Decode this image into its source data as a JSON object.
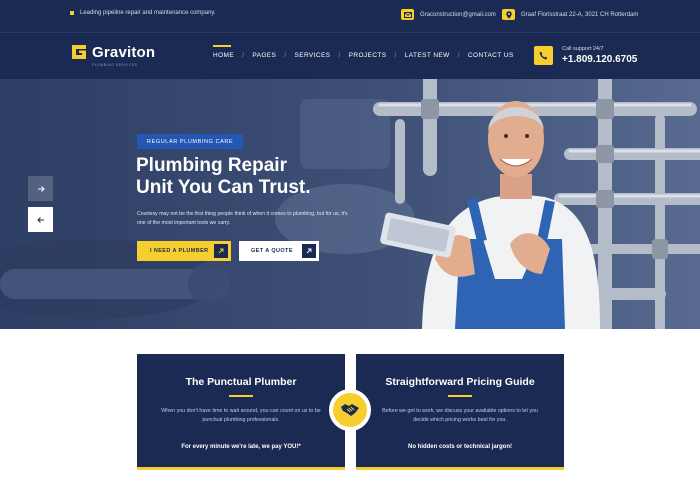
{
  "topbar": {
    "tagline": "Leading pipeline repair and maintenance company.",
    "email": "Graconstruction@gmail.com",
    "address": "Graaf Florisstraat 22-A, 3021 CH Rotterdam"
  },
  "header": {
    "logo_name": "Graviton",
    "logo_sub": "PLUMBING SERVICES",
    "nav": [
      "HOME",
      "PAGES",
      "SERVICES",
      "PROJECTS",
      "LATEST NEW",
      "CONTACT US"
    ],
    "active_nav": "HOME",
    "phone_label": "Call support 24/7",
    "phone_number": "+1.809.120.6705"
  },
  "hero": {
    "badge": "REGULAR PLUMBING CARE",
    "title_line1": "Plumbing Repair",
    "title_line2": "Unit You Can Trust.",
    "description": "Courtesy may not be the first thing people think of when it comes to plumbing, but for us, it's one of the most important tools we carry.",
    "primary_button": "I NEED A PLUMBER",
    "secondary_button": "GET A QUOTE"
  },
  "features": [
    {
      "title": "The Punctual Plumber",
      "text": "When you don't have time to wait around, you can count on us to be punctual plumbing professionals.",
      "footer": "For every minute we're late, we pay YOU!*"
    },
    {
      "title": "Straightforward Pricing Guide",
      "text": "Before we get to work, we discuss your available options to let you decide which pricing works best for you.",
      "footer": "No hidden costs or technical jargon!"
    }
  ],
  "colors": {
    "navy": "#1a2a52",
    "accent_yellow": "#f6cf2e",
    "badge_blue": "#2456b4"
  },
  "icons": {
    "tagline": "square-bullet-icon",
    "email": "envelope-icon",
    "address": "map-pin-icon",
    "phone": "phone-icon",
    "slider_next": "arrow-right-icon",
    "slider_prev": "arrow-left-icon",
    "card_divider": "handshake-icon"
  }
}
